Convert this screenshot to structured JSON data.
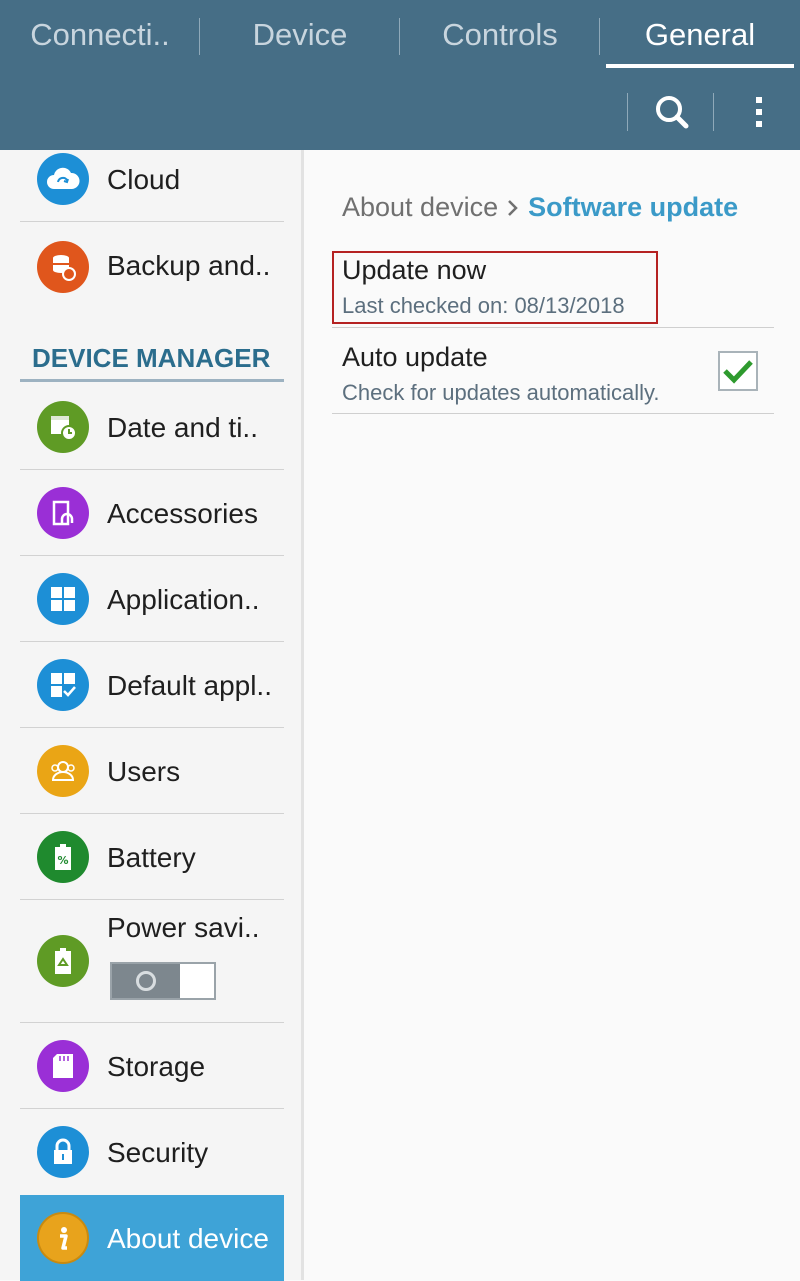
{
  "tabs": [
    {
      "label": "Connecti.."
    },
    {
      "label": "Device"
    },
    {
      "label": "Controls"
    },
    {
      "label": "General"
    }
  ],
  "sidebar": {
    "items_top": [
      {
        "label": "Cloud",
        "icon": "cloud-icon",
        "color": "#1d8fd6"
      },
      {
        "label": "Backup and..",
        "icon": "backup-icon",
        "color": "#e0561c"
      }
    ],
    "section_header": "DEVICE MANAGER",
    "items": [
      {
        "label": "Date and ti..",
        "icon": "calendar-clock-icon",
        "color": "#5f9b25"
      },
      {
        "label": "Accessories",
        "icon": "accessories-icon",
        "color": "#9a2fd6"
      },
      {
        "label": "Application..",
        "icon": "applications-grid-icon",
        "color": "#1d8fd6"
      },
      {
        "label": "Default appl..",
        "icon": "default-apps-icon",
        "color": "#1d8fd6"
      },
      {
        "label": "Users",
        "icon": "users-icon",
        "color": "#eaa515"
      },
      {
        "label": "Battery",
        "icon": "battery-icon",
        "color": "#1f8a2e"
      },
      {
        "label": "Power savi..",
        "icon": "power-saving-icon",
        "color": "#5f9b25"
      },
      {
        "label": "Storage",
        "icon": "storage-icon",
        "color": "#9a2fd6"
      },
      {
        "label": "Security",
        "icon": "lock-icon",
        "color": "#1d8fd6"
      },
      {
        "label": "About device",
        "icon": "info-icon",
        "color": "#e8a31c"
      }
    ],
    "power_saving_toggle": "off"
  },
  "content": {
    "breadcrumb": {
      "parent": "About device",
      "current": "Software update"
    },
    "update_now": {
      "title": "Update now",
      "subtitle": "Last checked on: 08/13/2018"
    },
    "auto_update": {
      "title": "Auto update",
      "subtitle": "Check for updates automatically.",
      "checked": true
    }
  },
  "colors": {
    "action_bar": "#466e86",
    "selected_item": "#3ea3d7",
    "accent": "#3b9ac8",
    "check_green": "#2e9a2e"
  }
}
